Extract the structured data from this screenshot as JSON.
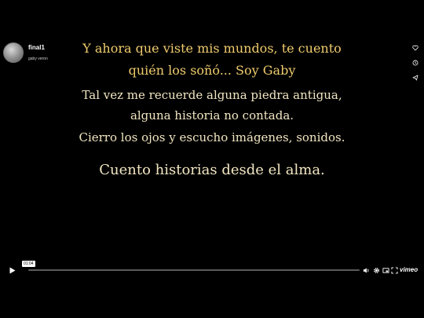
{
  "video": {
    "title": "final1",
    "author": "gaby veron",
    "current_time": "01:04",
    "progress": 0
  },
  "poem": {
    "line1": "Y ahora que viste mis mundos, te cuento",
    "line2": "quién los soñó...  Soy Gaby",
    "line3": "Tal vez me recuerde alguna piedra antigua,",
    "line4": "alguna historia no contada.",
    "line5": "Cierro los ojos y escucho imágenes, sonidos.",
    "line6": "Cuento historias desde el alma."
  },
  "side_actions": [
    {
      "icon": "heart-icon"
    },
    {
      "icon": "clock-icon"
    },
    {
      "icon": "share-icon"
    }
  ],
  "controls": {
    "brand": "vimeo",
    "icons": [
      "play-icon",
      "volume-icon",
      "settings-icon",
      "pip-icon",
      "fullscreen-icon"
    ]
  },
  "colors": {
    "background": "#000000",
    "poem_gold": "#f0cc6e",
    "poem_cream": "#f2e6c2",
    "track": "#5a5a5a"
  }
}
